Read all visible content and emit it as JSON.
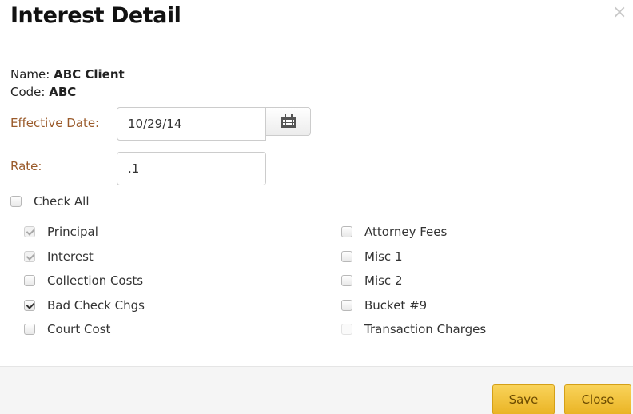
{
  "dialog": {
    "title": "Interest Detail",
    "close_glyph": "×"
  },
  "info": {
    "name_label": "Name:",
    "name_value": "ABC Client",
    "code_label": "Code:",
    "code_value": "ABC"
  },
  "effective_date": {
    "label": "Effective Date:",
    "value": "10/29/14",
    "icon": "calendar-icon"
  },
  "rate": {
    "label": "Rate:",
    "value": ".1"
  },
  "check_all": {
    "label": "Check All",
    "checked": false
  },
  "left_items": [
    {
      "label": "Principal",
      "checked": true,
      "disabled": true
    },
    {
      "label": "Interest",
      "checked": true,
      "disabled": true
    },
    {
      "label": "Collection Costs",
      "checked": false,
      "disabled": false
    },
    {
      "label": "Bad Check Chgs",
      "checked": true,
      "disabled": false
    },
    {
      "label": "Court Cost",
      "checked": false,
      "disabled": false
    }
  ],
  "right_items": [
    {
      "label": "Attorney Fees",
      "checked": false,
      "disabled": false
    },
    {
      "label": "Misc 1",
      "checked": false,
      "disabled": false
    },
    {
      "label": "Misc 2",
      "checked": false,
      "disabled": false
    },
    {
      "label": "Bucket #9",
      "checked": false,
      "disabled": false
    },
    {
      "label": "Transaction Charges",
      "checked": false,
      "disabled": true
    }
  ],
  "buttons": {
    "save": "Save",
    "close": "Close"
  },
  "colors": {
    "field_label": "#9a5a2a",
    "button_bg": "#eab425",
    "button_text": "#6b4a00"
  }
}
